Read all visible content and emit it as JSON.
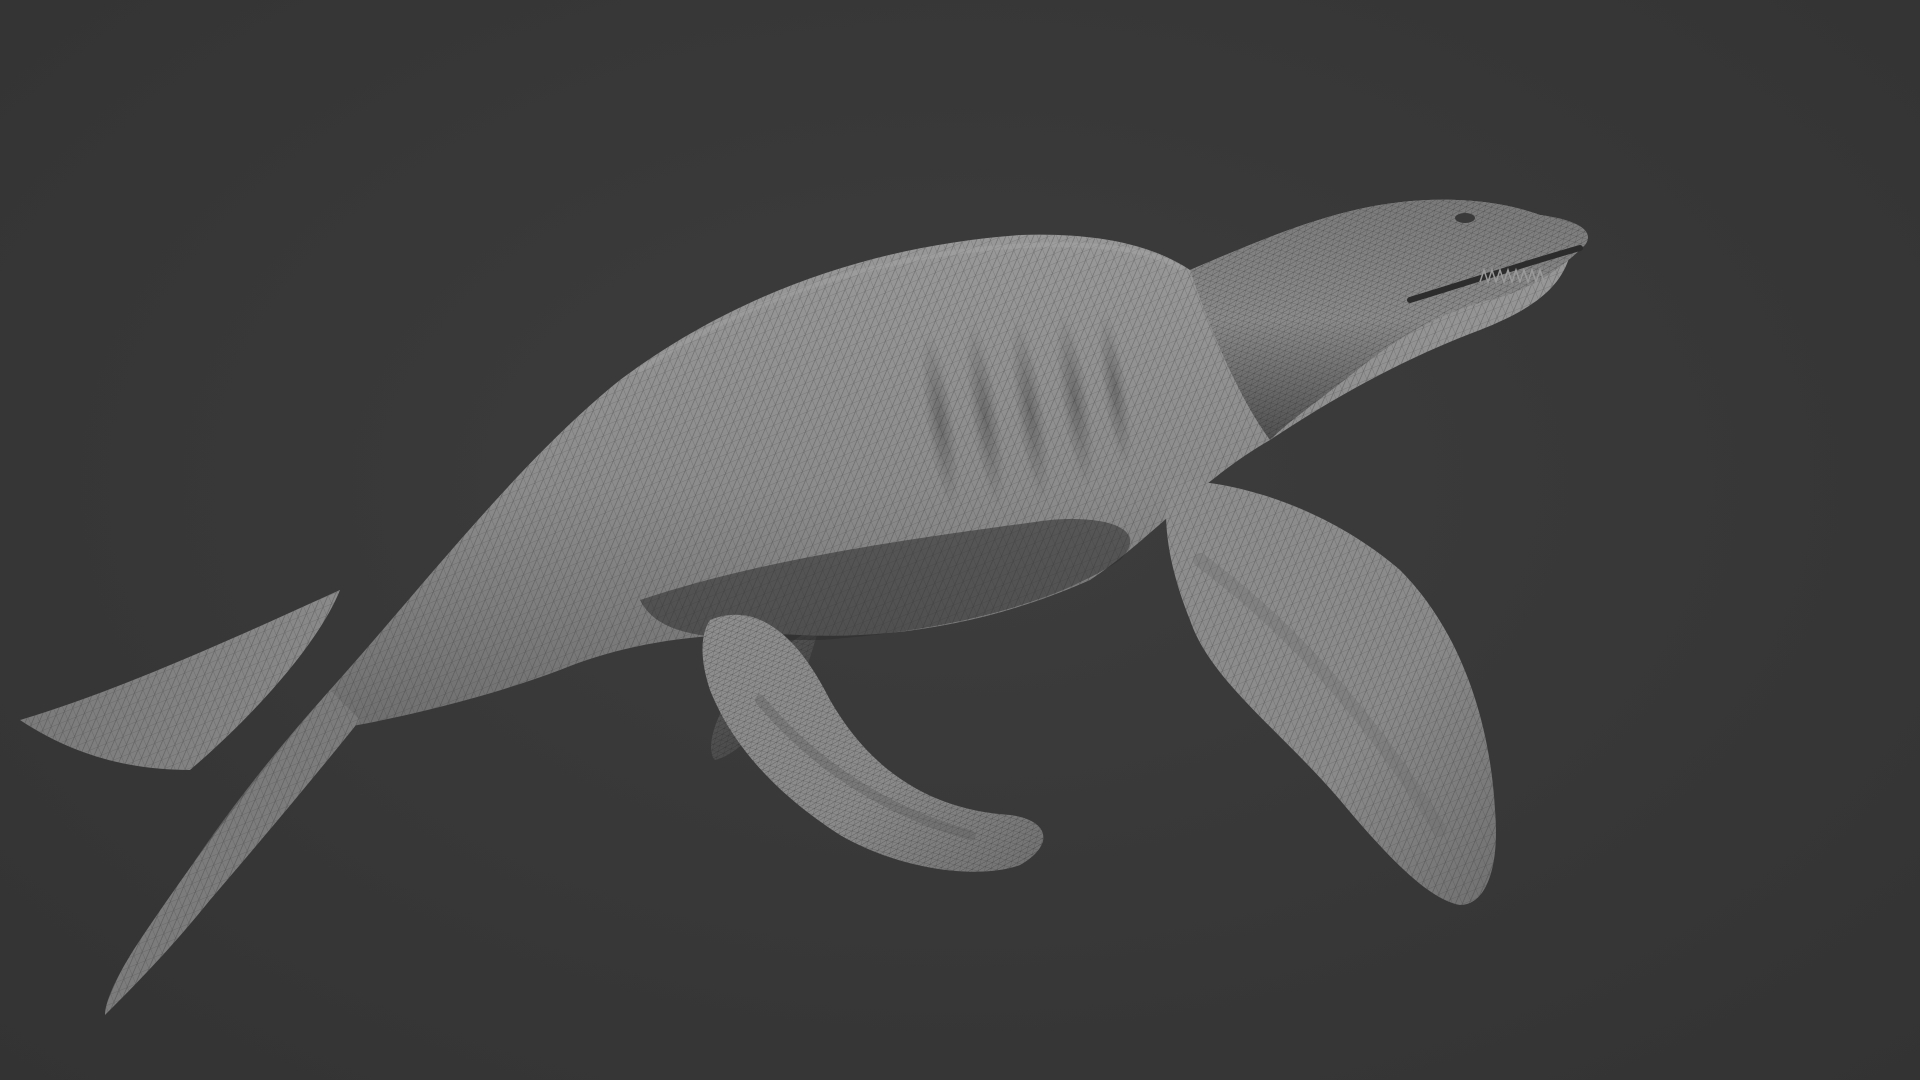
{
  "scene": {
    "background_color": "#383838",
    "model_base_color": "#8a8a8a",
    "model_shadow_color": "#3c3c3c",
    "wireframe_color": "#2a2a2a"
  }
}
